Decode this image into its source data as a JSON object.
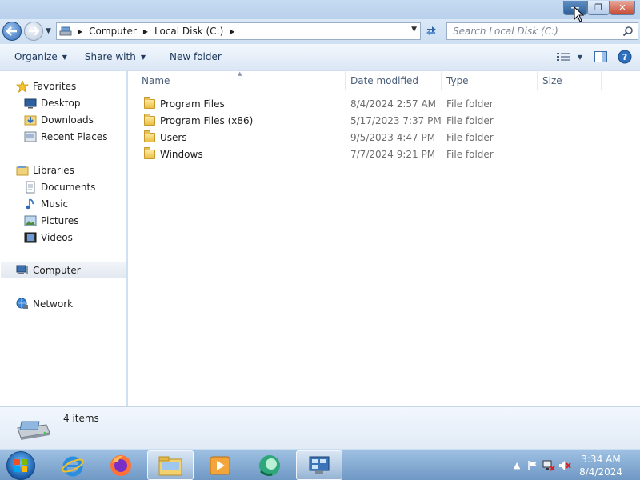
{
  "window": {
    "controls": {
      "minimize": "—",
      "maximize": "❐",
      "close": "✕"
    }
  },
  "address": {
    "breadcrumbs": [
      "Computer",
      "Local Disk (C:)"
    ],
    "search_placeholder": "Search Local Disk (C:)"
  },
  "toolbar": {
    "organize": "Organize",
    "share_with": "Share with",
    "new_folder": "New folder"
  },
  "nav": {
    "favorites": "Favorites",
    "desktop": "Desktop",
    "downloads": "Downloads",
    "recent_places": "Recent Places",
    "libraries": "Libraries",
    "documents": "Documents",
    "music": "Music",
    "pictures": "Pictures",
    "videos": "Videos",
    "computer": "Computer",
    "network": "Network"
  },
  "columns": {
    "name": "Name",
    "date_modified": "Date modified",
    "type": "Type",
    "size": "Size"
  },
  "files": [
    {
      "name": "Program Files",
      "date": "8/4/2024 2:57 AM",
      "type": "File folder"
    },
    {
      "name": "Program Files (x86)",
      "date": "5/17/2023 7:37 PM",
      "type": "File folder"
    },
    {
      "name": "Users",
      "date": "9/5/2023 4:47 PM",
      "type": "File folder"
    },
    {
      "name": "Windows",
      "date": "7/7/2024 9:21 PM",
      "type": "File folder"
    }
  ],
  "status": {
    "item_count": "4 items"
  },
  "taskbar": {
    "apps": [
      "internet-explorer",
      "firefox",
      "file-explorer",
      "media-player",
      "app-green",
      "remote-desktop"
    ],
    "time": "3:34 AM",
    "date": "8/4/2024"
  }
}
